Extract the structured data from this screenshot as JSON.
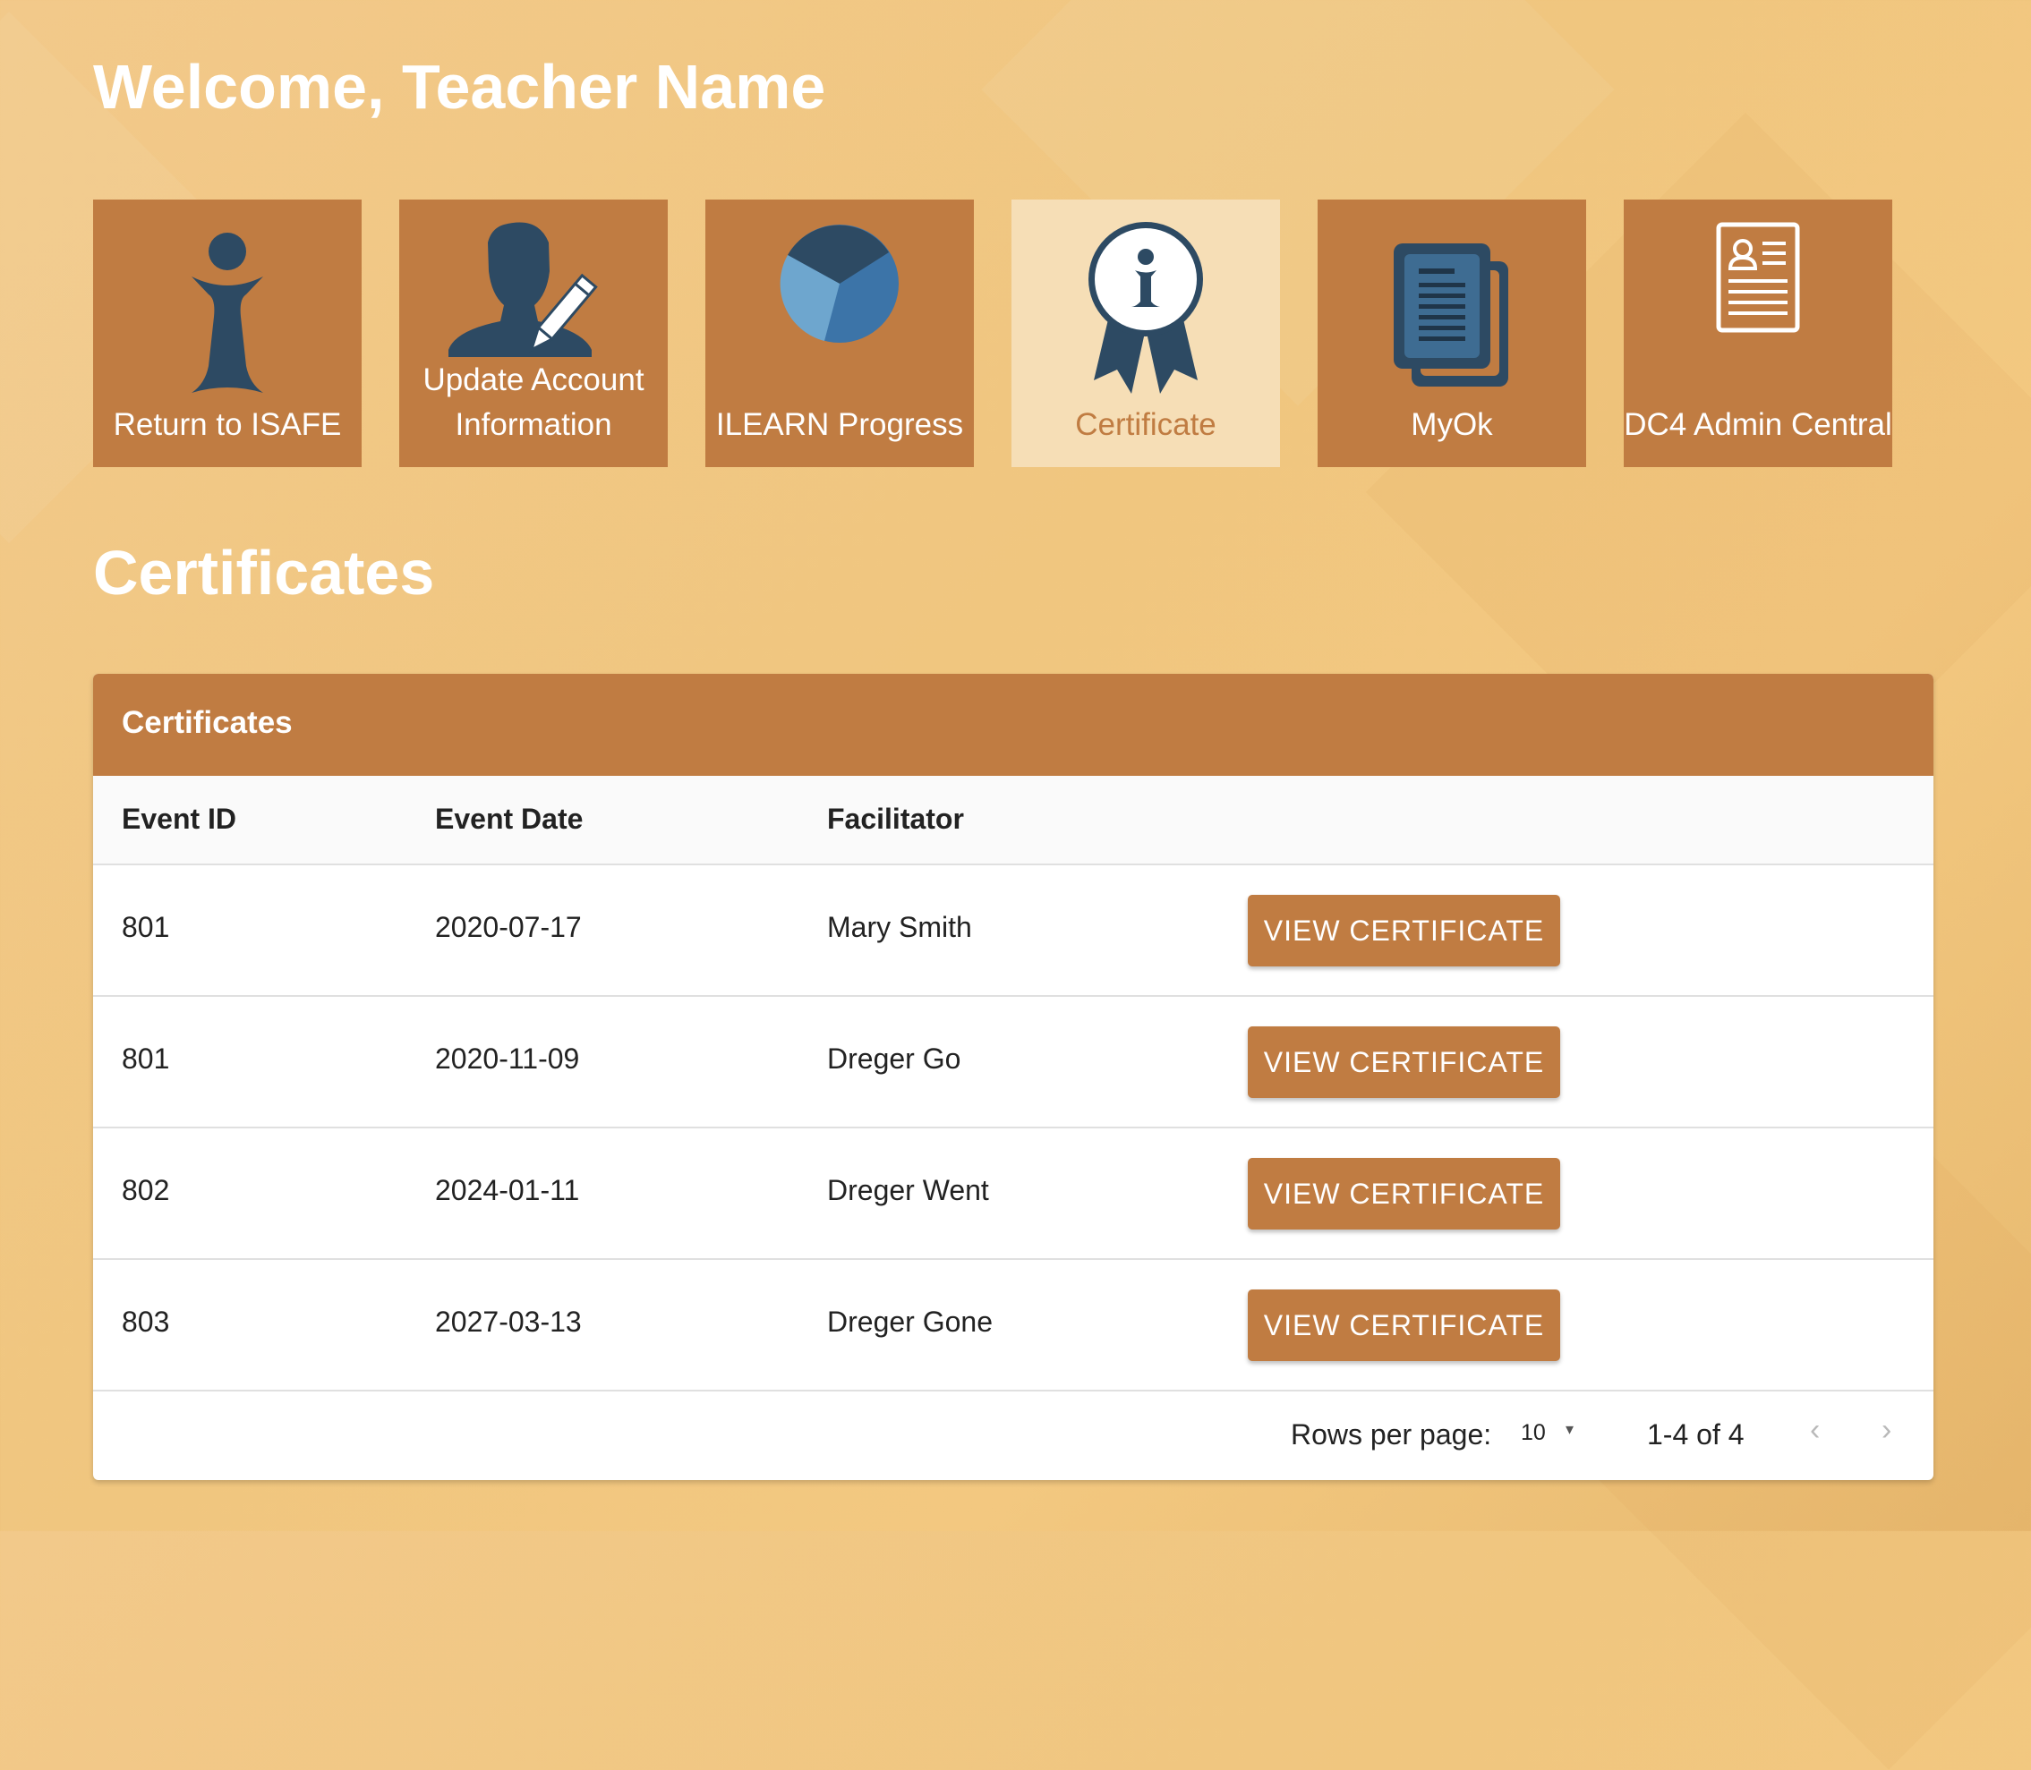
{
  "header": {
    "welcome": "Welcome, Teacher Name"
  },
  "tiles": [
    {
      "label": "Return to ISAFE",
      "icon": "isafe-person-icon"
    },
    {
      "label": "Update Account Information",
      "icon": "user-edit-icon"
    },
    {
      "label": "ILEARN Progress",
      "icon": "pie-chart-icon"
    },
    {
      "label": "Certificate",
      "icon": "award-ribbon-icon",
      "active": true
    },
    {
      "label": "MyOk",
      "icon": "documents-icon"
    },
    {
      "label": "DC4 Admin Central",
      "icon": "id-card-icon"
    }
  ],
  "section": {
    "title": "Certificates"
  },
  "table": {
    "title": "Certificates",
    "columns": [
      "Event ID",
      "Event Date",
      "Facilitator"
    ],
    "rows": [
      {
        "event_id": "801",
        "event_date": "2020-07-17",
        "facilitator": "Mary Smith",
        "action": "VIEW CERTIFICATE"
      },
      {
        "event_id": "801",
        "event_date": "2020-11-09",
        "facilitator": "Dreger Go",
        "action": "VIEW CERTIFICATE"
      },
      {
        "event_id": "802",
        "event_date": "2024-01-11",
        "facilitator": "Dreger Went",
        "action": "VIEW CERTIFICATE"
      },
      {
        "event_id": "803",
        "event_date": "2027-03-13",
        "facilitator": "Dreger Gone",
        "action": "VIEW CERTIFICATE"
      }
    ]
  },
  "pagination": {
    "rows_per_page_label": "Rows per page:",
    "rows_per_page": "10",
    "range": "1-4 of 4",
    "prev": "‹",
    "next": "›"
  },
  "colors": {
    "accent": "#c07c42",
    "active_tile": "#f6deb6",
    "icon_dark": "#2d4a63",
    "background": "#f0c67f"
  }
}
